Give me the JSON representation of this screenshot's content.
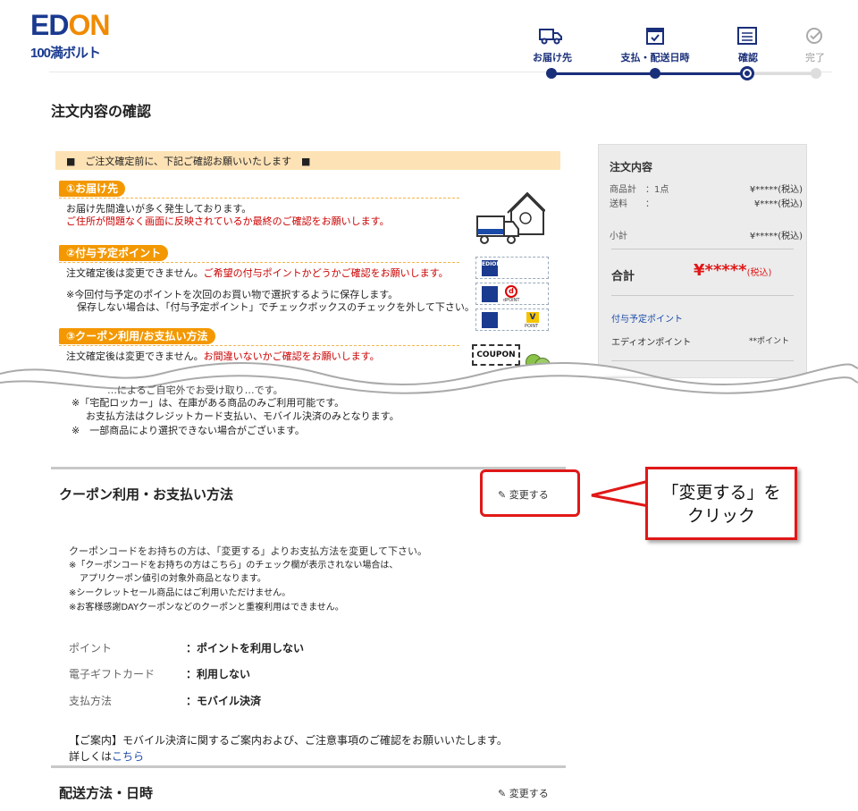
{
  "logo": {
    "ed": "ED",
    "on": "ON",
    "sub": "100満ボルト"
  },
  "steps": [
    {
      "label": "お届け先",
      "icon": "truck-icon"
    },
    {
      "label": "支払・配送日時",
      "icon": "calendar-icon"
    },
    {
      "label": "確認",
      "icon": "checklist-icon"
    },
    {
      "label": "完了",
      "icon": "check-circle-icon"
    }
  ],
  "page_title": "注文内容の確認",
  "notice": {
    "header": "■　ご注文確定前に、下記ご確認お願いいたします　■",
    "sec1": {
      "tag": "①お届け先",
      "line1": "お届け先間違いが多く発生しております。",
      "line2": "ご住所が問題なく画面に反映されているか最終のご確認をお願いします。"
    },
    "sec2": {
      "tag": "②付与予定ポイント",
      "line1a": "注文確定後は変更できません。",
      "line1b": "ご希望の付与ポイントかどうかご確認をお願いします。",
      "line2": "※今回付与予定のポイントを次回のお買い物で選択するように保存します。",
      "line3": "保存しない場合は、「付与予定ポイント」でチェックボックスのチェックを外して下さい。"
    },
    "sec3": {
      "tag": "③クーポン利用/お支払い方法",
      "line1a": "注文確定後は変更できません。",
      "line1b": "お間違いないかご確認をお願いします。",
      "cut1": "…によるご自宅外でお受け取り…です。",
      "cut2": "※「宅配ロッカー」は、在庫がある商品のみご利用可能です。",
      "cut3": "お支払方法はクレジットカード支払い、モバイル決済のみとなります。",
      "cut4": "※　一部商品により選択できない場合がございます。"
    },
    "badges": {
      "edion": "EDION",
      "dpoint": "dPOINT",
      "vpoint": "POINT",
      "coupon": "COUPON"
    }
  },
  "summary": {
    "title": "注文内容",
    "item_label": "商品計",
    "item_qty": "：1点",
    "item_val": "¥*****(税込)",
    "ship_label": "送料",
    "ship_sep": "：",
    "ship_val": "¥****(税込)",
    "subtotal_label": "小計",
    "subtotal_val": "¥*****(税込)",
    "total_label": "合計",
    "total_val": "¥*****",
    "total_tax": "(税込)",
    "points_link": "付与予定ポイント",
    "edion_point_label": "エディオンポイント",
    "edion_point_val": "**ポイント"
  },
  "coupon_section": {
    "title": "クーポン利用・お支払い方法",
    "change": "変更する",
    "desc1": "クーポンコードをお持ちの方は、「変更する」よりお支払方法を変更して下さい。",
    "desc2": "※「クーポンコードをお持ちの方はこちら」のチェック欄が表示されない場合は、",
    "desc3": "アプリクーポン値引の対象外商品となります。",
    "desc4": "※シークレットセール商品にはご利用いただけません。",
    "desc5": "※お客様感謝DAYクーポンなどのクーポンと重複利用はできません。",
    "point_label": "ポイント",
    "point_val": "：ポイントを利用しない",
    "gift_label": "電子ギフトカード",
    "gift_val": "：利用しない",
    "pay_label": "支払方法",
    "pay_val": "：モバイル決済",
    "notice_a": "【ご案内】",
    "notice_b": "モバイル決済に関するご案内および、ご注意事項のご確認をお願いいたします。",
    "detail_a": "詳しくは",
    "detail_b": "こちら"
  },
  "callout": {
    "line1": "「変更する」を",
    "line2": "クリック"
  },
  "delivery_section": {
    "title": "配送方法・日時",
    "change": "変更する"
  },
  "colors": {
    "brand": "#1a2f7a",
    "accent": "#f39800",
    "alert": "#e01818"
  }
}
